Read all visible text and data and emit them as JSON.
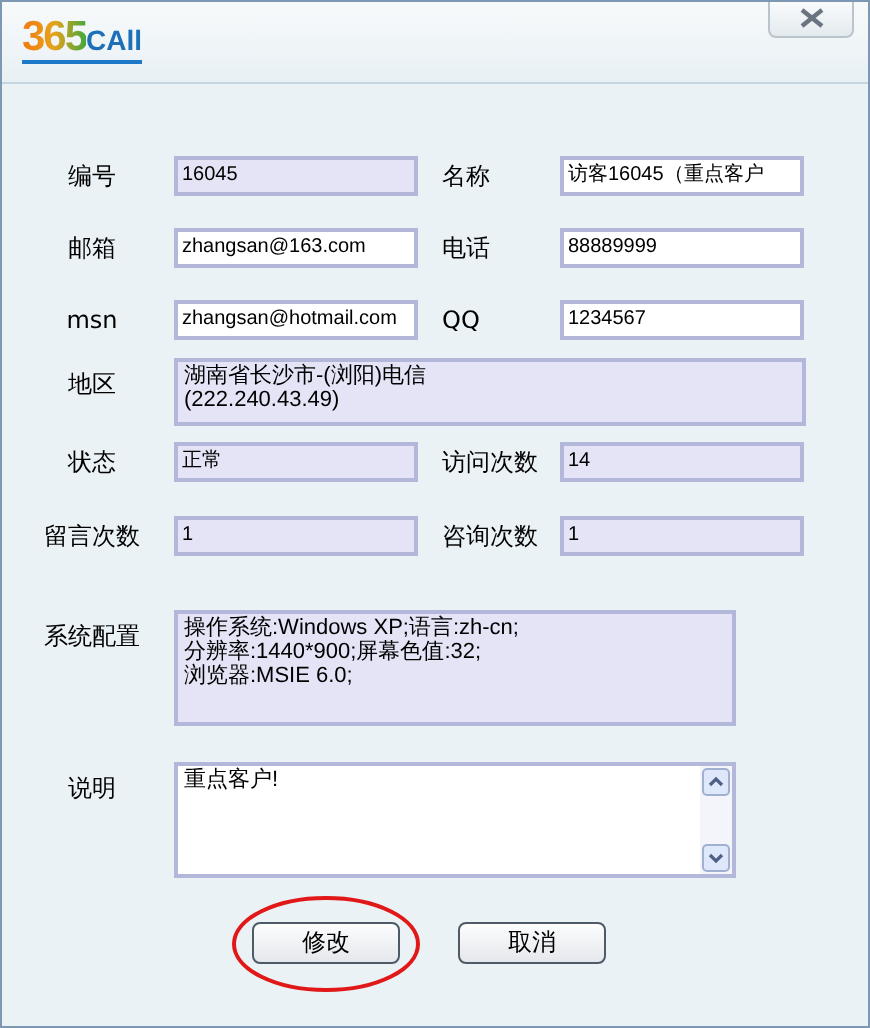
{
  "logo": {
    "digits": "365",
    "word": "CAll"
  },
  "rows": [
    {
      "cells": [
        {
          "label": "编号",
          "value": "16045",
          "editable": false
        },
        {
          "label": "名称",
          "value": "访客16045（重点客户",
          "editable": true
        }
      ]
    },
    {
      "cells": [
        {
          "label": "邮箱",
          "value": "zhangsan@163.com",
          "editable": true
        },
        {
          "label": "电话",
          "value": "88889999",
          "editable": true
        }
      ]
    },
    {
      "cells": [
        {
          "label": "msn",
          "value": "zhangsan@hotmail.com",
          "editable": true
        },
        {
          "label": "QQ",
          "value": "1234567",
          "editable": true
        }
      ]
    },
    {
      "cells": [
        {
          "label": "地区",
          "lines": [
            "湖南省长沙市-(浏阳)电信",
            "(222.240.43.49)"
          ],
          "editable": false
        }
      ]
    },
    {
      "cells": [
        {
          "label": "状态",
          "value": "正常",
          "editable": false
        },
        {
          "label": "访问次数",
          "value": "14",
          "editable": false
        }
      ]
    },
    {
      "cells": [
        {
          "label": "留言次数",
          "value": "1",
          "editable": false
        },
        {
          "label": "咨询次数",
          "value": "1",
          "editable": false
        }
      ]
    },
    {
      "cells": [
        {
          "label": "系统配置",
          "lines": [
            "操作系统:Windows XP;语言:zh-cn;",
            "分辨率:1440*900;屏幕色值:32;",
            "浏览器:MSIE 6.0;"
          ],
          "editable": false
        }
      ]
    },
    {
      "cells": [
        {
          "label": "说明",
          "lines": [
            "重点客户!"
          ],
          "editable": true,
          "scrollbar": true
        }
      ]
    }
  ],
  "buttons": [
    {
      "label": "修改",
      "circled": true
    },
    {
      "label": "取消",
      "circled": false
    }
  ]
}
